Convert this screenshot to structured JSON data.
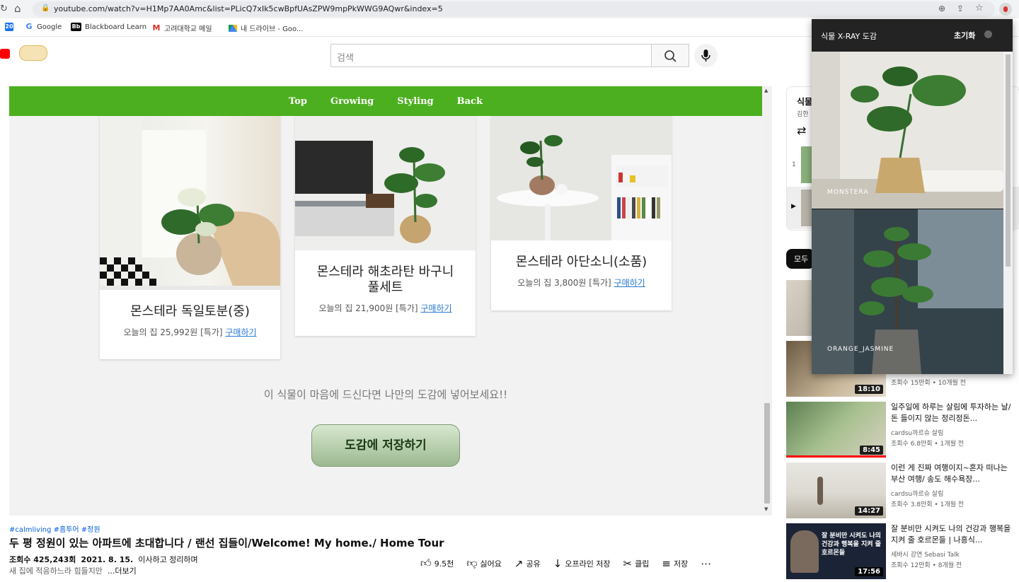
{
  "browser": {
    "url": "youtube.com/watch?v=H1Mp7AA0Amc&list=PLicQ7xIk5cwBpfUAsZPW9mpPkWWG9AQwr&index=5",
    "bookmarks": [
      {
        "icon": "20",
        "label": ""
      },
      {
        "icon": "G",
        "label": "Google"
      },
      {
        "icon": "Bb",
        "label": "Blackboard Learn"
      },
      {
        "icon": "M",
        "label": "고려대학교 메일"
      },
      {
        "icon": "drive",
        "label": "내 드라이브 - Goo..."
      }
    ]
  },
  "youtube": {
    "search_placeholder": "검색"
  },
  "embedded": {
    "nav": [
      "Top",
      "Growing",
      "Styling",
      "Back"
    ],
    "cards": [
      {
        "title": "몬스테라 독일토분(중)",
        "price": "오늘의 집 25,992원 [특가] ",
        "link": "구매하기"
      },
      {
        "title": "몬스테라 해초라탄 바구니 풀세트",
        "price": "오늘의 집 21,900원 [특가] ",
        "link": "구매하기"
      },
      {
        "title": "몬스테라 아단소니(소품)",
        "price": "오늘의 집 3,800원 [특가] ",
        "link": "구매하기"
      }
    ],
    "cta_text": "이 식물이 마음에 드신다면 나만의 도감에 넣어보세요!!",
    "save_button": "도감에 저장하기"
  },
  "video": {
    "tags": "#calmliving #홈투어 #정원",
    "title": "두 평 정원이 있는 아파트에 초대합니다 / 랜선 집들이/Welcome! My home./ Home Tour",
    "views": "조회수 425,243회",
    "date": "2021. 8. 15.",
    "desc1": "이사하고 정리하며",
    "desc2": "새 집에 적응하느라 힘들지만",
    "more": "...더보기",
    "actions": {
      "like": "9.5천",
      "dislike": "싫어요",
      "share": "공유",
      "offline": "오프라인 저장",
      "clip": "클립",
      "save": "저장"
    }
  },
  "sidebar": {
    "playlist_title_partial": "식물",
    "playlist_channel_partial": "김한",
    "playlist_index": "1",
    "filter_chip": "모두",
    "videos": [
      {
        "duration": "",
        "title": "",
        "channel": "",
        "stats": ""
      },
      {
        "duration": "18:10",
        "title": "",
        "channel": "",
        "stats": "조회수 15만회 • 10개월 전"
      },
      {
        "duration": "8:45",
        "title": "일주일에 하루는 살림에 투자하는 날/ 돈 들이지 않는 정리정돈...",
        "channel": "cardsu까르슈 살림",
        "stats": "조회수 6.8만회 • 1개월 전"
      },
      {
        "duration": "14:27",
        "title": "이런 게 진짜 여행이지~혼자 떠나는 부산 여행/ 송도 해수욕장...",
        "channel": "cardsu까르슈 살림",
        "stats": "조회수 3.8만회 • 1개월 전"
      },
      {
        "duration": "17:56",
        "title": "잘 분비만 시켜도 나의 건강과 행복을 지켜 줄 호르몬들 | 나흥식...",
        "channel": "세바시 강연 Sebasi Talk",
        "stats": "조회수 12만회 • 8개월 전"
      }
    ],
    "thumb_caption_4": "잘 분비만 시켜도 나의 건강과 행복을 지켜 줄 호르몬들"
  },
  "extension": {
    "title": "식물 X-RAY 도감",
    "reset": "초기화",
    "plants": [
      "MONSTERA",
      "ORANGE_JASMINE"
    ]
  },
  "colors": {
    "green_nav": "#4caf1f",
    "link": "#2779d0",
    "popup_bg": "#232323"
  }
}
